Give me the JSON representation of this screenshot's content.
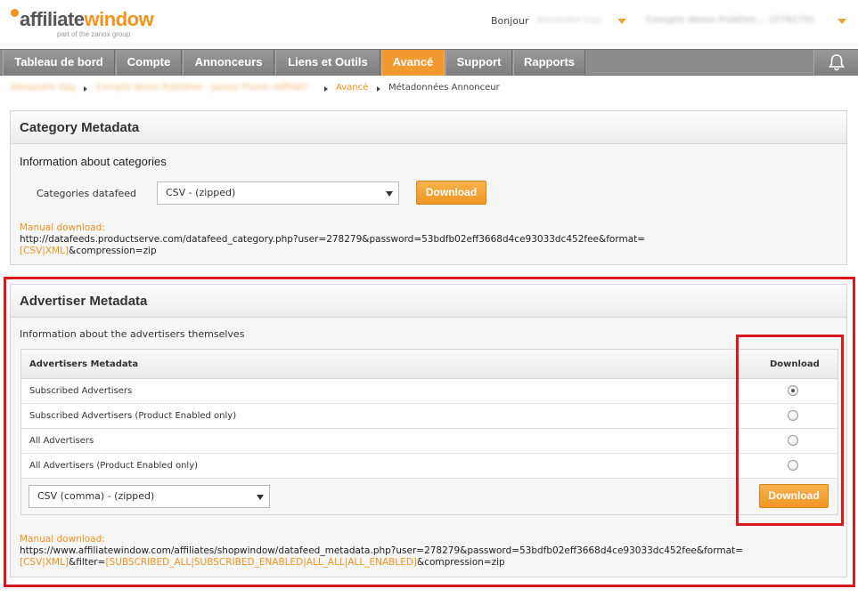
{
  "header": {
    "logo_main_a": "affiliate",
    "logo_main_b": "window",
    "logo_sub": "part of the zanox group",
    "greeting": "Bonjour",
    "user_name": "Alexandre Gay",
    "account": "Compte demo Publish... (278279)"
  },
  "nav": {
    "items": [
      {
        "label": "Tableau de bord"
      },
      {
        "label": "Compte"
      },
      {
        "label": "Annonceurs"
      },
      {
        "label": "Liens et Outils"
      },
      {
        "label": "Avancé"
      },
      {
        "label": "Support"
      },
      {
        "label": "Rapports"
      }
    ],
    "active_index": 4
  },
  "breadcrumb": {
    "items": [
      "Alexandre Gay",
      "Compte demo Publisher - James Flavet (Affiliat)",
      "Avancé",
      "Métadonnées Annonceur"
    ]
  },
  "category_panel": {
    "title": "Category Metadata",
    "info": "Information about categories",
    "datafeed_label": "Categories datafeed",
    "select_value": "CSV - (zipped)",
    "download_label": "Download",
    "manual_label": "Manual download:",
    "manual_url": "http://datafeeds.productserve.com/datafeed_category.php?user=278279&password=53bdfb02eff3668d4ce93033dc452fee&format=",
    "manual_formats": "[CSV|XML]",
    "manual_tail": "&compression=zip"
  },
  "advertiser_panel": {
    "title": "Advertiser Metadata",
    "info": "Information about the advertisers themselves",
    "table_header": "Advertisers Metadata",
    "download_header": "Download",
    "rows": [
      {
        "label": "Subscribed Advertisers",
        "selected": true
      },
      {
        "label": "Subscribed Advertisers (Product Enabled only)",
        "selected": false
      },
      {
        "label": "All Advertisers",
        "selected": false
      },
      {
        "label": "All Advertisers (Product Enabled only)",
        "selected": false
      }
    ],
    "select_value": "CSV (comma) - (zipped)",
    "download_label": "Download",
    "manual_label": "Manual download:",
    "manual_url": "https://www.affiliatewindow.com/affiliates/shopwindow/datafeed_metadata.php?user=278279&password=53bdfb02eff3668d4ce93033dc452fee&format=",
    "manual_formats": "[CSV|XML]",
    "manual_filter_label": "&filter=",
    "manual_filters": "[SUBSCRIBED_ALL|SUBSCRIBED_ENABLED|ALL_ALL|ALL_ENABLED]",
    "manual_tail": "&compression=zip"
  },
  "colors": {
    "accent": "#f29320",
    "nav_bg": "#8c8c8c",
    "highlight": "#d9181e"
  },
  "icons": {
    "bell": "bell-icon",
    "caret": "chevron-down-icon"
  }
}
